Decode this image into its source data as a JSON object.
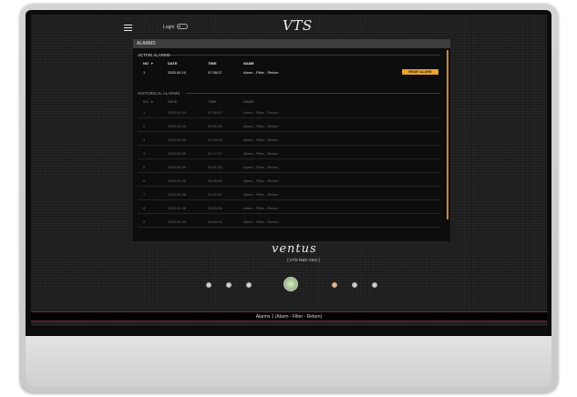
{
  "topbar": {
    "login_label": "Login",
    "logo": "VTS"
  },
  "panel": {
    "title": "ALARMS",
    "active": {
      "title": "ACTIVE ALARMS",
      "columns": [
        "NO",
        "DATE",
        "TIME",
        "NAME"
      ],
      "rows": [
        {
          "no": "1",
          "date": "2020.00.10",
          "time": "07:38:37",
          "name": "Alarm - Filter - Return"
        }
      ],
      "reset_label": "RESET ALARM"
    },
    "historical": {
      "title": "HISTORICAL ALARMS",
      "columns": [
        "NO",
        "DATE",
        "TIME",
        "NAME"
      ],
      "rows": [
        {
          "no": "1",
          "date": "2020.00.10",
          "time": "07:38:37",
          "name": "Alarm - Filter - Return"
        },
        {
          "no": "2",
          "date": "2020.00.10",
          "time": "05:01:38",
          "name": "Alarm - Filter - Return"
        },
        {
          "no": "3",
          "date": "2020.00.09",
          "time": "10:05:04",
          "name": "Alarm - Filter - Return"
        },
        {
          "no": "4",
          "date": "2020.00.09",
          "time": "07:17:47",
          "name": "Alarm - Filter - Return"
        },
        {
          "no": "5",
          "date": "2020.00.09",
          "time": "05:01:38",
          "name": "Alarm - Filter - Return"
        },
        {
          "no": "6",
          "date": "2020.00.06",
          "time": "15:35:05",
          "name": "Alarm - Filter - Return"
        },
        {
          "no": "7",
          "date": "2020.00.06",
          "time": "11:25:10",
          "name": "Alarm - Filter - Return"
        },
        {
          "no": "8",
          "date": "2020.00.06",
          "time": "05:43:38",
          "name": "Alarm - Filter - Return"
        },
        {
          "no": "9",
          "date": "2020.00.03",
          "time": "05:54:33",
          "name": "Alarm - Filter - Return"
        }
      ]
    }
  },
  "brand": {
    "name": "ventus",
    "model": "[ VTS R&D VKO ]"
  },
  "status": {
    "text": "Alarms 1 (Alarm - Filter - Return)"
  },
  "colors": {
    "accent": "#e8a430",
    "status_border": "#6a2a3a",
    "screen_bg": "#191919"
  }
}
